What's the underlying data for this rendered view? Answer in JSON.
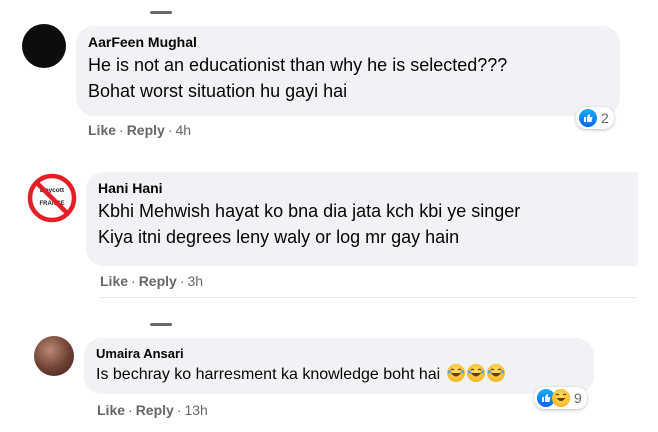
{
  "comments": [
    {
      "author": "AarFeen Mughal",
      "lines": [
        "He is not an educationist than why he is selected???",
        "Bohat worst situation hu gayi hai"
      ],
      "actions": {
        "like": "Like",
        "reply": "Reply",
        "time": "4h"
      },
      "reactions": {
        "icons": [
          "like-icon"
        ],
        "count": "2"
      }
    },
    {
      "author": "Hani Hani",
      "avatar_text": [
        "Boycott",
        "FRANCE"
      ],
      "lines": [
        "Kbhi Mehwish hayat ko bna dia jata kch kbi ye singer",
        "Kiya itni degrees leny waly or log mr gay hain"
      ],
      "actions": {
        "like": "Like",
        "reply": "Reply",
        "time": "3h"
      }
    },
    {
      "author": "Umaira Ansari",
      "lines": [
        "Is bechray ko harresment ka knowledge boht hai"
      ],
      "emoji_count": 3,
      "actions": {
        "like": "Like",
        "reply": "Reply",
        "time": "13h"
      },
      "reactions": {
        "icons": [
          "like-icon",
          "haha-icon"
        ],
        "count": "9"
      }
    }
  ],
  "separator": "·",
  "colors": {
    "bubble": "#f0f2f5",
    "meta": "#65676b",
    "like_blue": "#0a63f4",
    "boycott_red": "#e41e26"
  }
}
